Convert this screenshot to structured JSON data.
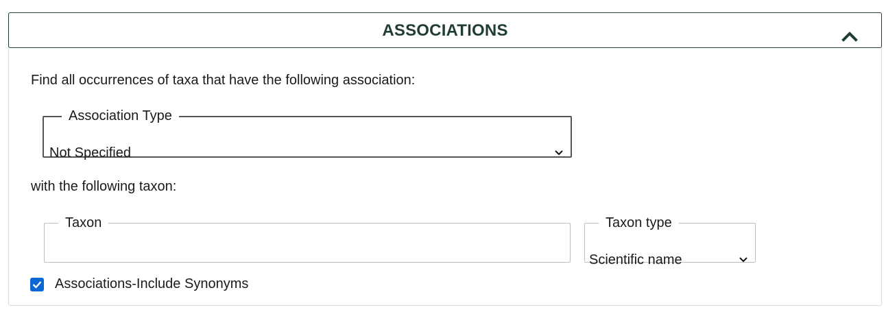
{
  "panel": {
    "title": "ASSOCIATIONS",
    "collapse_icon": "chevron-up-icon",
    "title_color": "#1f3d33"
  },
  "intro_text": "Find all occurrences of taxa that have the following association:",
  "association_type": {
    "legend": "Association Type",
    "selected": "Not Specified"
  },
  "with_text": "with the following taxon:",
  "taxon": {
    "legend": "Taxon",
    "value": ""
  },
  "taxon_type": {
    "legend": "Taxon type",
    "selected": "Scientific name"
  },
  "include_synonyms": {
    "label": "Associations-Include Synonyms",
    "checked": true,
    "accent": "#0b66d6"
  }
}
